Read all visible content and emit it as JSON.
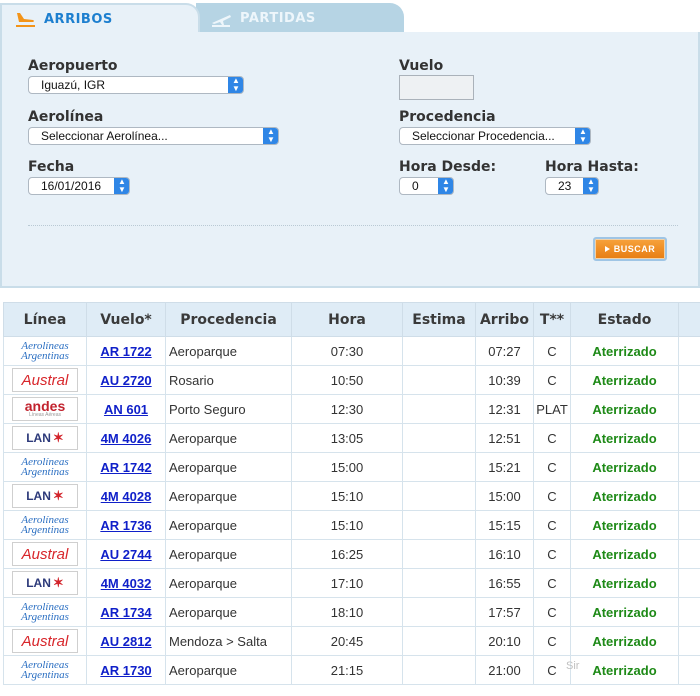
{
  "tabs": {
    "arribos": "ARRIBOS",
    "partidas": "PARTIDAS"
  },
  "form": {
    "aeropuerto_label": "Aeropuerto",
    "aeropuerto_value": "Iguazú, IGR",
    "vuelo_label": "Vuelo",
    "aerolinea_label": "Aerolínea",
    "aerolinea_value": "Seleccionar Aerolínea...",
    "procedencia_label": "Procedencia",
    "procedencia_value": "Seleccionar Procedencia...",
    "fecha_label": "Fecha",
    "fecha_value": "16/01/2016",
    "hora_desde_label": "Hora Desde:",
    "hora_desde_value": "0",
    "hora_hasta_label": "Hora Hasta:",
    "hora_hasta_value": "23",
    "buscar_label": "BUSCAR"
  },
  "table": {
    "headers": [
      "Línea",
      "Vuelo*",
      "Procedencia",
      "Hora",
      "Estima",
      "Arribo",
      "T**",
      "Estado"
    ],
    "rows": [
      {
        "airline": "Aerolíneas Argentinas",
        "flight": "AR 1722",
        "origin": "Aeroparque",
        "hora": "07:30",
        "estima": "",
        "arribo": "07:27",
        "terminal": "C",
        "estado": "Aterrizado"
      },
      {
        "airline": "Austral",
        "flight": "AU 2720",
        "origin": "Rosario",
        "hora": "10:50",
        "estima": "",
        "arribo": "10:39",
        "terminal": "C",
        "estado": "Aterrizado"
      },
      {
        "airline": "andes",
        "flight": "AN 601",
        "origin": "Porto Seguro",
        "hora": "12:30",
        "estima": "",
        "arribo": "12:31",
        "terminal": "PLAT",
        "estado": "Aterrizado"
      },
      {
        "airline": "LAN",
        "flight": "4M 4026",
        "origin": "Aeroparque",
        "hora": "13:05",
        "estima": "",
        "arribo": "12:51",
        "terminal": "C",
        "estado": "Aterrizado"
      },
      {
        "airline": "Aerolíneas Argentinas",
        "flight": "AR 1742",
        "origin": "Aeroparque",
        "hora": "15:00",
        "estima": "",
        "arribo": "15:21",
        "terminal": "C",
        "estado": "Aterrizado"
      },
      {
        "airline": "LAN",
        "flight": "4M 4028",
        "origin": "Aeroparque",
        "hora": "15:10",
        "estima": "",
        "arribo": "15:00",
        "terminal": "C",
        "estado": "Aterrizado"
      },
      {
        "airline": "Aerolíneas Argentinas",
        "flight": "AR 1736",
        "origin": "Aeroparque",
        "hora": "15:10",
        "estima": "",
        "arribo": "15:15",
        "terminal": "C",
        "estado": "Aterrizado"
      },
      {
        "airline": "Austral",
        "flight": "AU 2744",
        "origin": "Aeroparque",
        "hora": "16:25",
        "estima": "",
        "arribo": "16:10",
        "terminal": "C",
        "estado": "Aterrizado"
      },
      {
        "airline": "LAN",
        "flight": "4M 4032",
        "origin": "Aeroparque",
        "hora": "17:10",
        "estima": "",
        "arribo": "16:55",
        "terminal": "C",
        "estado": "Aterrizado"
      },
      {
        "airline": "Aerolíneas Argentinas",
        "flight": "AR 1734",
        "origin": "Aeroparque",
        "hora": "18:10",
        "estima": "",
        "arribo": "17:57",
        "terminal": "C",
        "estado": "Aterrizado"
      },
      {
        "airline": "Austral",
        "flight": "AU 2812",
        "origin": "Mendoza > Salta",
        "hora": "20:45",
        "estima": "",
        "arribo": "20:10",
        "terminal": "C",
        "estado": "Aterrizado"
      },
      {
        "airline": "Aerolíneas Argentinas",
        "flight": "AR 1730",
        "origin": "Aeroparque",
        "hora": "21:15",
        "estima": "",
        "arribo": "21:00",
        "terminal": "C",
        "estado": "Aterrizado"
      }
    ]
  },
  "logos": {
    "ar_line1": "Aerolíneas",
    "ar_line2": "Argentinas",
    "au": "Austral",
    "an": "andes",
    "an_sub": "Líneas Aéreas",
    "lan": "LAN"
  },
  "watermark": "Sir"
}
